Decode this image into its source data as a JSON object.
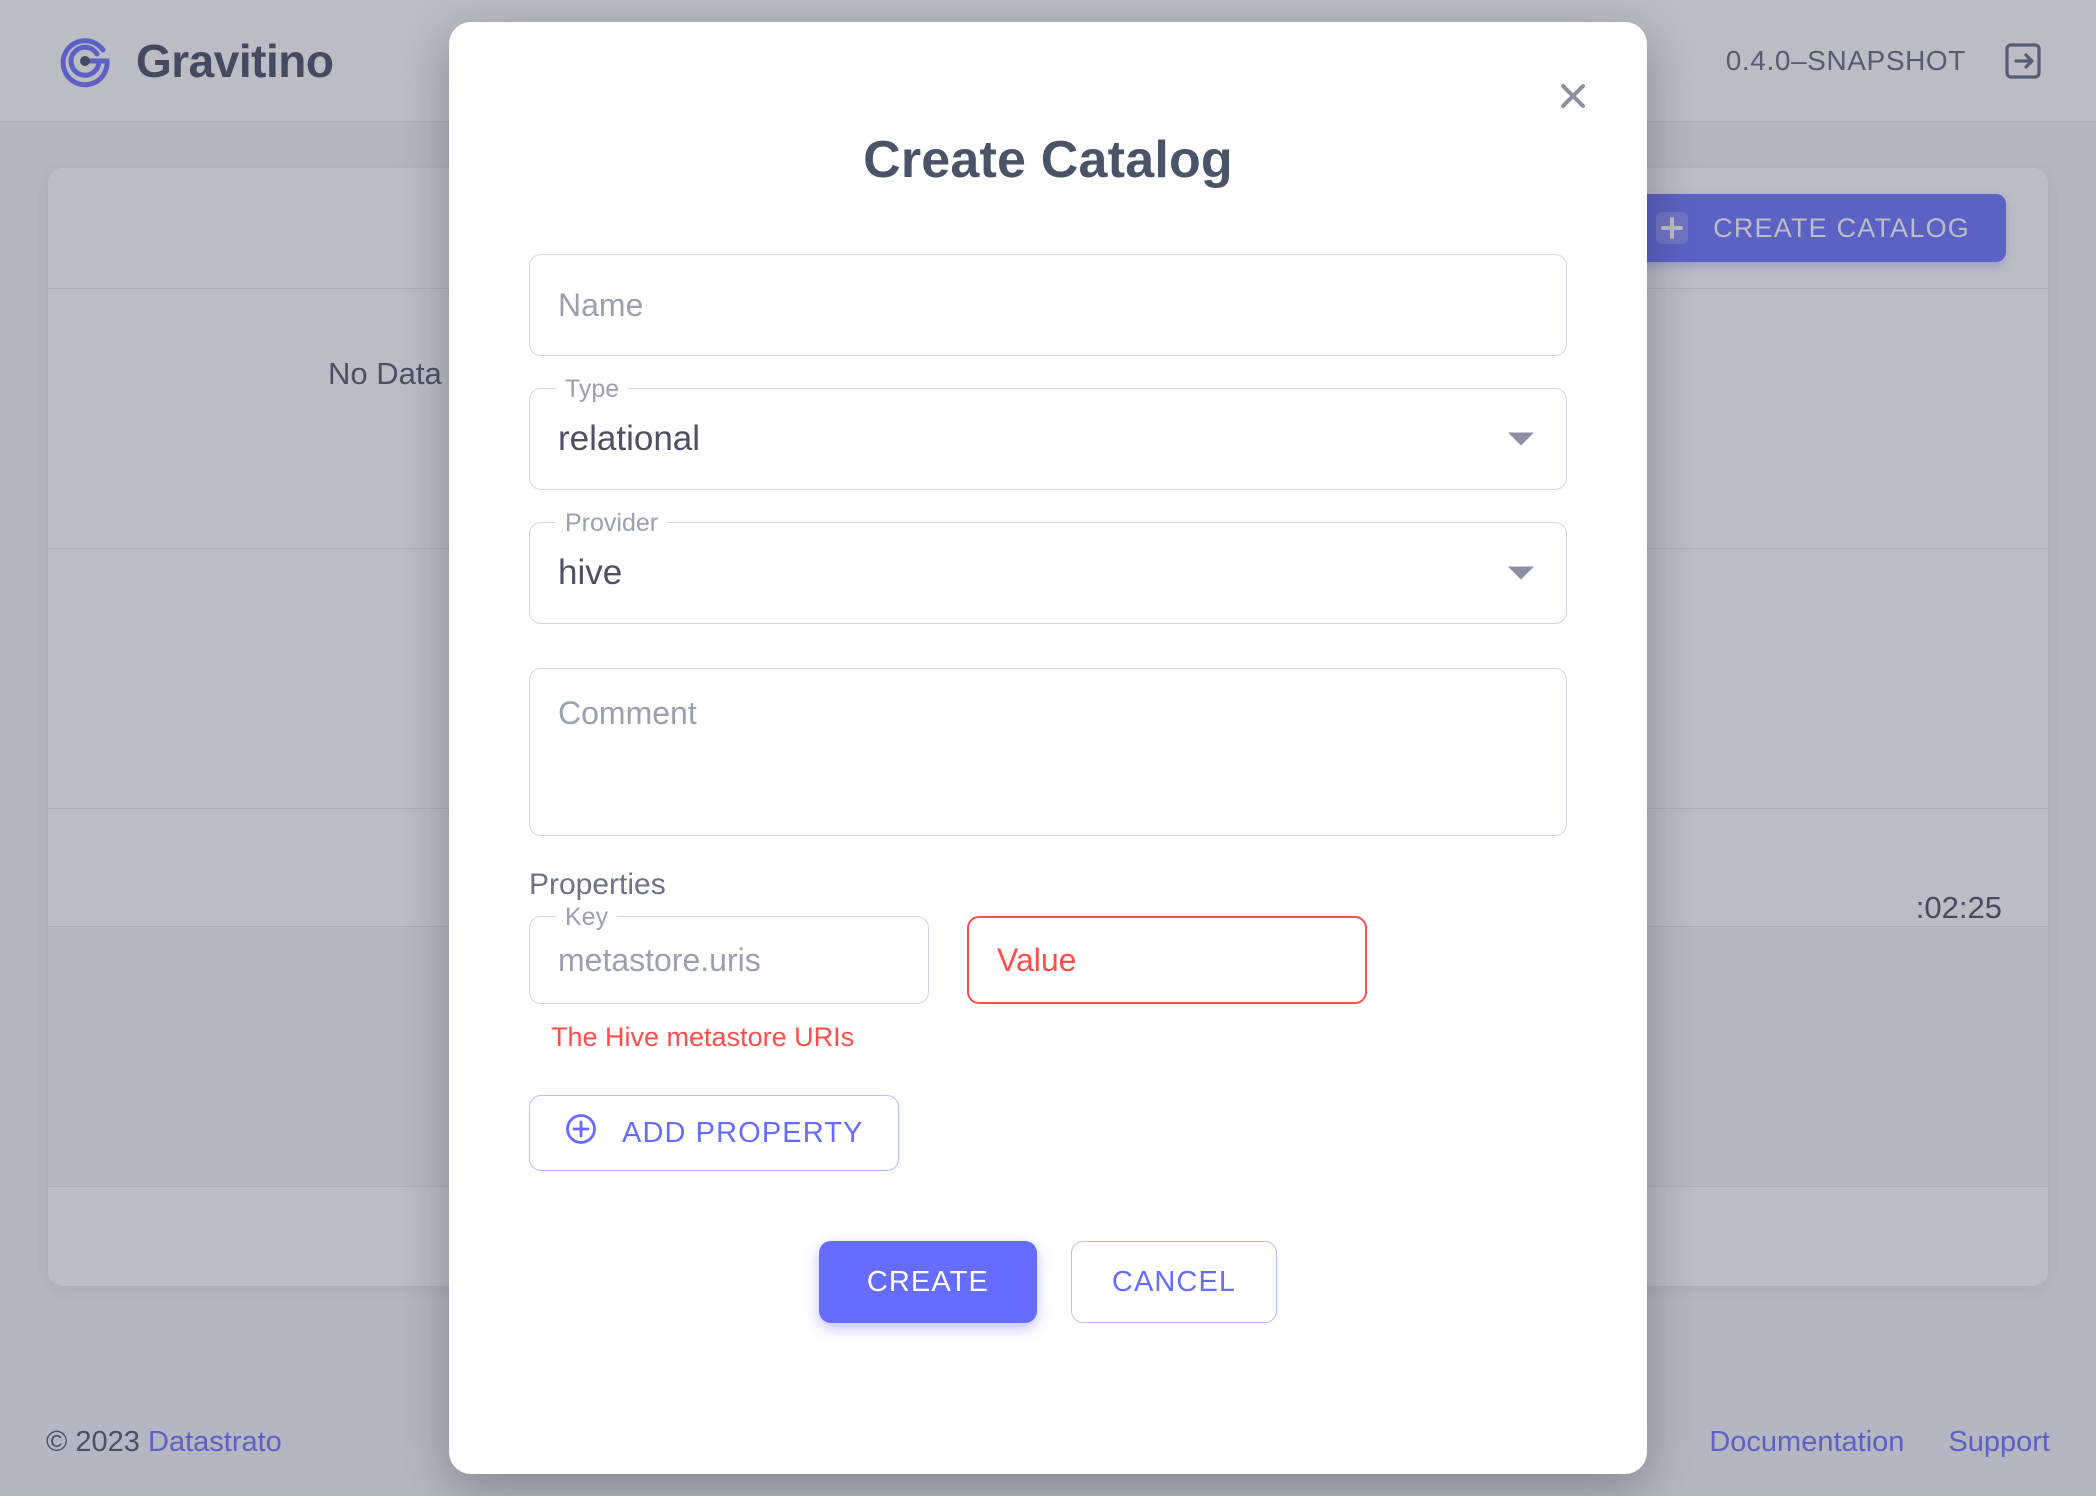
{
  "appbar": {
    "brand_name": "Gravitino",
    "brand_icon": "gravitino-logo-icon",
    "version": "0.4.0–SNAPSHOT",
    "logout_icon": "logout-icon"
  },
  "main": {
    "create_catalog_label": "CREATE CATALOG",
    "create_catalog_icon": "plus-square-icon",
    "empty_text": "No Data",
    "partial_timestamp": ":02:25"
  },
  "footer": {
    "copyright": "© 2023",
    "company_link": "Datastrato",
    "documentation_link": "Documentation",
    "support_link": "Support"
  },
  "modal": {
    "title": "Create Catalog",
    "close_icon": "close-icon",
    "name": {
      "placeholder": "Name",
      "value": ""
    },
    "type": {
      "label": "Type",
      "value": "relational",
      "arrow_icon": "chevron-down-icon"
    },
    "provider": {
      "label": "Provider",
      "value": "hive",
      "arrow_icon": "chevron-down-icon"
    },
    "comment": {
      "placeholder": "Comment",
      "value": ""
    },
    "properties": {
      "section_label": "Properties",
      "rows": [
        {
          "key_label": "Key",
          "key_placeholder": "metastore.uris",
          "key_value": "",
          "value_placeholder": "Value",
          "value_value": "",
          "value_has_error": true,
          "helper_text": "The Hive metastore URIs"
        }
      ],
      "add_property_label": "ADD PROPERTY",
      "add_property_icon": "plus-circle-icon"
    },
    "actions": {
      "submit_label": "CREATE",
      "cancel_label": "CANCEL"
    }
  },
  "colors": {
    "accent": "#666cff",
    "error": "#ff4d49",
    "text": "#4b5163",
    "muted": "#9ba0ae",
    "page_bg": "#f4f5fa"
  }
}
